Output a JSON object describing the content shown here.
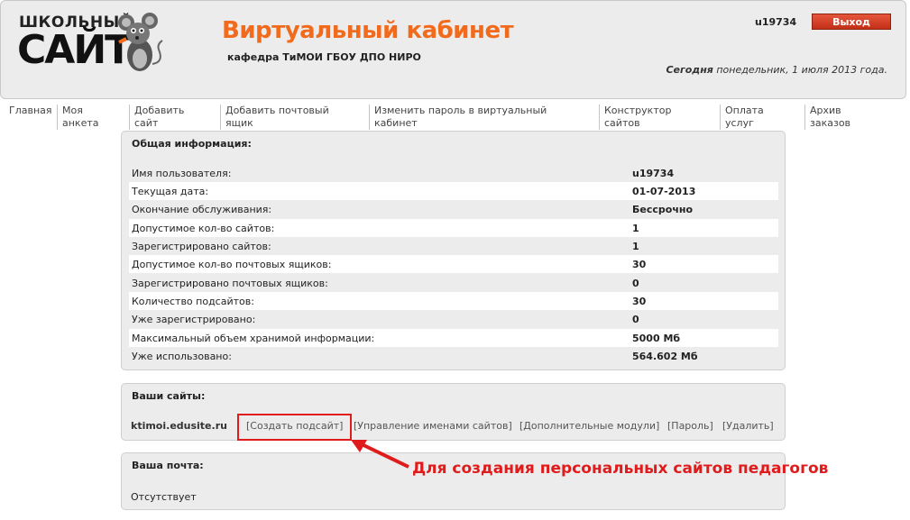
{
  "header": {
    "logo_top": "ШКОЛЬНЫЙ",
    "logo_bottom": "САЙТ",
    "title": "Виртуальный кабинет",
    "department": "кафедра ТиМОИ ГБОУ ДПО НИРО",
    "username": "u19734",
    "logout_label": "Выход",
    "today_label": "Сегодня",
    "today_value": " понедельник, 1 июля 2013 года."
  },
  "nav": [
    {
      "label": "Главная"
    },
    {
      "label": "Моя\nанкета"
    },
    {
      "label": "Добавить\nсайт"
    },
    {
      "label": "Добавить почтовый\nящик"
    },
    {
      "label": "Изменить пароль в виртуальный\nкабинет"
    },
    {
      "label": "Конструктор\nсайтов"
    },
    {
      "label": "Оплата\nуслуг"
    },
    {
      "label": "Архив\nзаказов"
    }
  ],
  "general": {
    "title": "Общая информация:",
    "rows": [
      {
        "label": "Имя пользователя:",
        "value": "u19734"
      },
      {
        "label": "Текущая дата:",
        "value": "01-07-2013"
      },
      {
        "label": "Окончание обслуживания:",
        "value": "Бессрочно"
      },
      {
        "label": "Допустимое кол-во сайтов:",
        "value": "1"
      },
      {
        "label": "Зарегистрировано сайтов:",
        "value": "1"
      },
      {
        "label": "Допустимое кол-во почтовых ящиков:",
        "value": "30"
      },
      {
        "label": "Зарегистрировано почтовых ящиков:",
        "value": "0"
      },
      {
        "label": "Количество подсайтов:",
        "value": "30"
      },
      {
        "label": "Уже зарегистрировано:",
        "value": "0"
      },
      {
        "label": "Максимальный объем хранимой информации:",
        "value": "5000 Мб"
      },
      {
        "label": "Уже использовано:",
        "value": "564.602 Мб"
      }
    ]
  },
  "sites": {
    "title": "Ваши сайты:",
    "site_name": "ktimoi.edusite.ru",
    "links": [
      {
        "label": "[Создать подсайт]"
      },
      {
        "label": "[Управление именами сайтов]"
      },
      {
        "label": "[Дополнительные модули]"
      },
      {
        "label": "[Пароль]"
      },
      {
        "label": "[Удалить]"
      }
    ]
  },
  "annotation": "Для создания персональных сайтов педагогов",
  "mail": {
    "title": "Ваша почта:",
    "status": "Отсутствует"
  },
  "colors": {
    "accent_orange": "#f26b1d",
    "logout_red": "#c42f17",
    "annotation_red": "#e01b1b"
  }
}
